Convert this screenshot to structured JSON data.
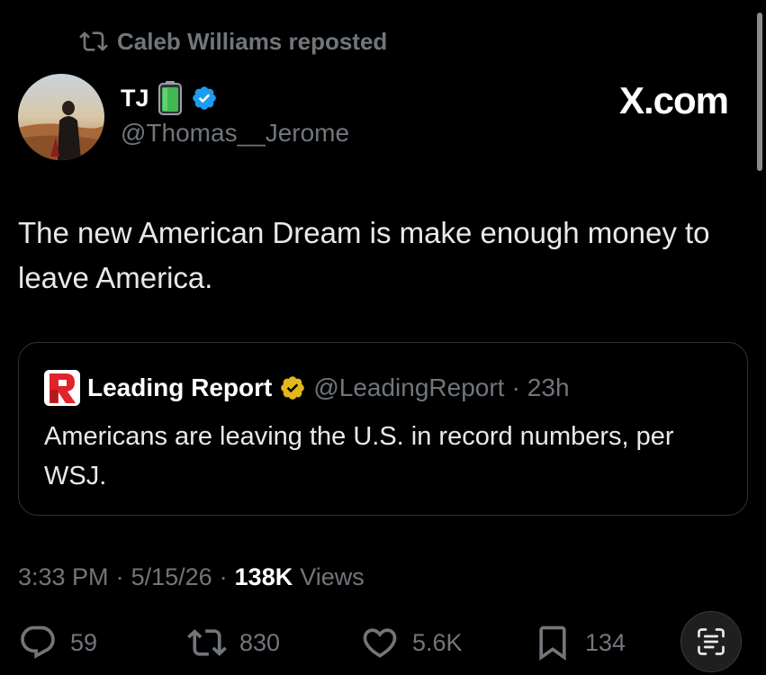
{
  "repost": {
    "text": "Caleb Williams reposted",
    "icon": "repost-icon"
  },
  "author": {
    "name": "TJ",
    "emoji": "battery-icon",
    "verified": "verified-badge-icon",
    "handle": "@Thomas__Jerome"
  },
  "watermark": "X.com",
  "tweet": {
    "text": "The new American Dream is make enough money to leave America."
  },
  "quote": {
    "name": "Leading Report",
    "handle": "@LeadingReport",
    "separator": "·",
    "time": "23h",
    "text": "Americans are leaving the U.S. in record numbers, per WSJ."
  },
  "meta": {
    "time": "3:33 PM",
    "sep1": "·",
    "date": "5/15/26",
    "sep2": "·",
    "views_count": "138K",
    "views_label": "Views"
  },
  "actions": {
    "replies": "59",
    "reposts": "830",
    "likes": "5.6K",
    "bookmarks": "134"
  },
  "colors": {
    "background": "#000000",
    "text": "#e7e9ea",
    "secondary": "#71767b",
    "verified_blue": "#1d9bf0",
    "verified_gold": "#e2b719",
    "battery_green": "#3fb950",
    "brand_red": "#e0242a"
  }
}
